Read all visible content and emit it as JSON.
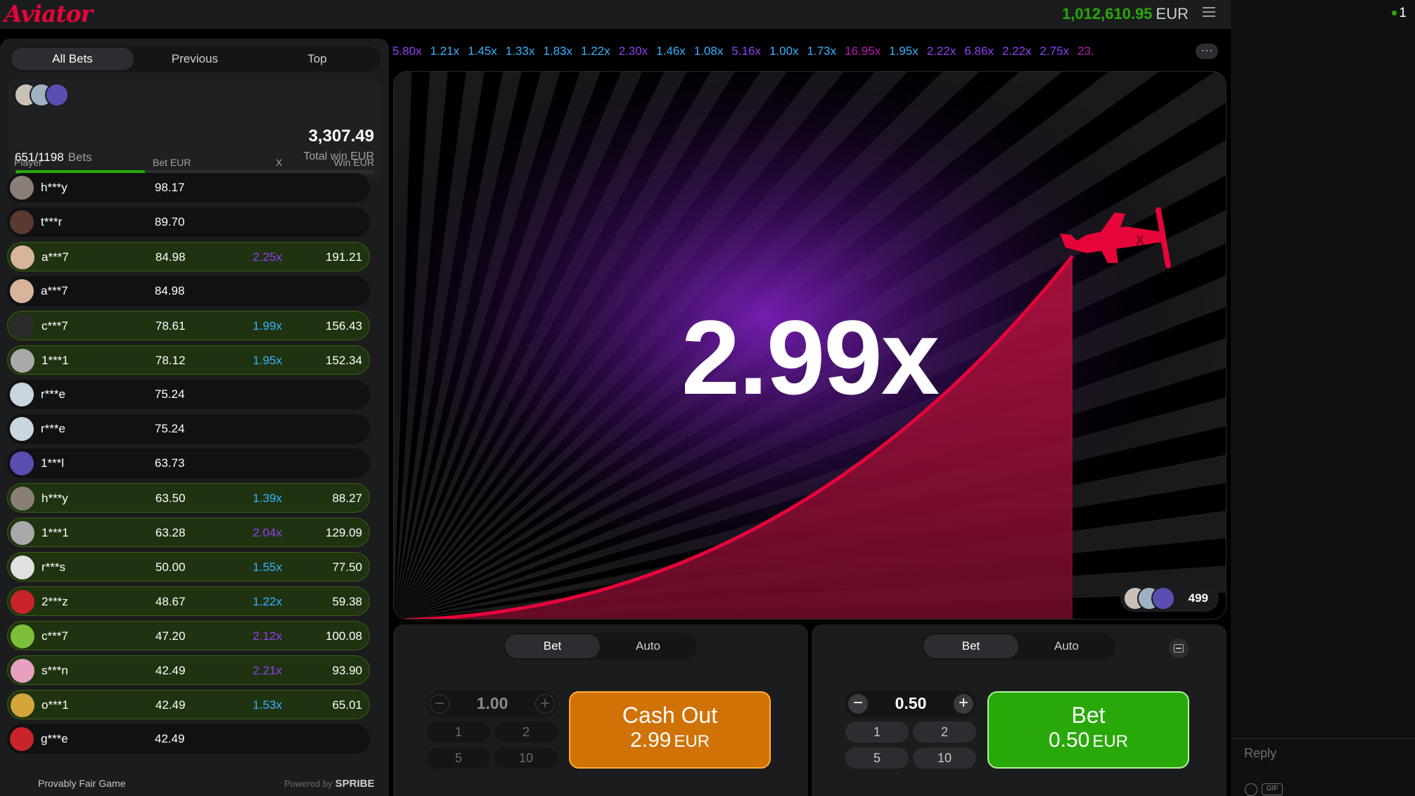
{
  "header": {
    "logo": "Aviator",
    "balance": "1,012,610.95",
    "currency": "EUR"
  },
  "left_panel": {
    "tabs": [
      {
        "label": "All Bets",
        "active": true
      },
      {
        "label": "Previous",
        "active": false
      },
      {
        "label": "Top",
        "active": false
      }
    ],
    "bets_count": "651/1198",
    "bets_label": "Bets",
    "bets_progress": 0.36,
    "total_win": "3,307.49",
    "total_win_label": "Total win EUR",
    "columns": {
      "player": "Player",
      "bet": "Bet EUR",
      "x": "X",
      "win": "Win EUR"
    },
    "rows": [
      {
        "player": "h***y",
        "bet": "98.17",
        "x": "",
        "win": "",
        "won": false,
        "x_color": "",
        "avatar_color": "#8a7f76"
      },
      {
        "player": "t***r",
        "bet": "89.70",
        "x": "",
        "win": "",
        "won": false,
        "x_color": "",
        "avatar_color": "#5a3a30"
      },
      {
        "player": "a***7",
        "bet": "84.98",
        "x": "2.25x",
        "win": "191.21",
        "won": true,
        "x_color": "#913ef8",
        "avatar_color": "#d9b49c"
      },
      {
        "player": "a***7",
        "bet": "84.98",
        "x": "",
        "win": "",
        "won": false,
        "x_color": "",
        "avatar_color": "#d9b49c"
      },
      {
        "player": "c***7",
        "bet": "78.61",
        "x": "1.99x",
        "win": "156.43",
        "won": true,
        "x_color": "#34b4ff",
        "avatar_color": "#2b2b2b"
      },
      {
        "player": "1***1",
        "bet": "78.12",
        "x": "1.95x",
        "win": "152.34",
        "won": true,
        "x_color": "#34b4ff",
        "avatar_color": "#a9a9a9"
      },
      {
        "player": "r***e",
        "bet": "75.24",
        "x": "",
        "win": "",
        "won": false,
        "x_color": "",
        "avatar_color": "#c9d6e0"
      },
      {
        "player": "r***e",
        "bet": "75.24",
        "x": "",
        "win": "",
        "won": false,
        "x_color": "",
        "avatar_color": "#c9d6e0"
      },
      {
        "player": "1***l",
        "bet": "63.73",
        "x": "",
        "win": "",
        "won": false,
        "x_color": "",
        "avatar_color": "#5a4fb0"
      },
      {
        "player": "h***y",
        "bet": "63.50",
        "x": "1.39x",
        "win": "88.27",
        "won": true,
        "x_color": "#34b4ff",
        "avatar_color": "#8a7f76"
      },
      {
        "player": "1***1",
        "bet": "63.28",
        "x": "2.04x",
        "win": "129.09",
        "won": true,
        "x_color": "#913ef8",
        "avatar_color": "#a9a9a9"
      },
      {
        "player": "r***s",
        "bet": "50.00",
        "x": "1.55x",
        "win": "77.50",
        "won": true,
        "x_color": "#34b4ff",
        "avatar_color": "#e0e0e0"
      },
      {
        "player": "2***z",
        "bet": "48.67",
        "x": "1.22x",
        "win": "59.38",
        "won": true,
        "x_color": "#34b4ff",
        "avatar_color": "#c8242a"
      },
      {
        "player": "c***7",
        "bet": "47.20",
        "x": "2.12x",
        "win": "100.08",
        "won": true,
        "x_color": "#913ef8",
        "avatar_color": "#7bbf3a"
      },
      {
        "player": "s***n",
        "bet": "42.49",
        "x": "2.21x",
        "win": "93.90",
        "won": true,
        "x_color": "#913ef8",
        "avatar_color": "#e7a0c0"
      },
      {
        "player": "o***1",
        "bet": "42.49",
        "x": "1.53x",
        "win": "65.01",
        "won": true,
        "x_color": "#34b4ff",
        "avatar_color": "#d4a53a"
      },
      {
        "player": "g***e",
        "bet": "42.49",
        "x": "",
        "win": "",
        "won": false,
        "x_color": "",
        "avatar_color": "#c8242a"
      }
    ],
    "footer_fair": "Provably Fair Game",
    "footer_powered": "Powered by",
    "footer_brand": "SPRIBE"
  },
  "history": [
    {
      "v": "5.80x",
      "c": "purple"
    },
    {
      "v": "1.21x",
      "c": "blue"
    },
    {
      "v": "1.45x",
      "c": "blue"
    },
    {
      "v": "1.33x",
      "c": "blue"
    },
    {
      "v": "1.83x",
      "c": "blue"
    },
    {
      "v": "1.22x",
      "c": "blue"
    },
    {
      "v": "2.30x",
      "c": "purple"
    },
    {
      "v": "1.46x",
      "c": "blue"
    },
    {
      "v": "1.08x",
      "c": "blue"
    },
    {
      "v": "5.16x",
      "c": "purple"
    },
    {
      "v": "1.00x",
      "c": "blue"
    },
    {
      "v": "1.73x",
      "c": "blue"
    },
    {
      "v": "16.95x",
      "c": "pink"
    },
    {
      "v": "1.95x",
      "c": "blue"
    },
    {
      "v": "2.22x",
      "c": "purple"
    },
    {
      "v": "6.86x",
      "c": "purple"
    },
    {
      "v": "2.22x",
      "c": "purple"
    },
    {
      "v": "2.75x",
      "c": "purple"
    },
    {
      "v": "23.",
      "c": "pink"
    }
  ],
  "game": {
    "multiplier": "2.99x",
    "online_count": "499"
  },
  "panels": [
    {
      "tabs": [
        "Bet",
        "Auto"
      ],
      "stake": "1.00",
      "quick": [
        "1",
        "2",
        "5",
        "10"
      ],
      "button_line1": "Cash Out",
      "button_line2": "2.99",
      "button_currency": "EUR",
      "button_color": "#d07206",
      "button_border": "#ffad3a"
    },
    {
      "tabs": [
        "Bet",
        "Auto"
      ],
      "stake": "0.50",
      "quick": [
        "1",
        "2",
        "5",
        "10"
      ],
      "button_line1": "Bet",
      "button_line2": "0.50",
      "button_currency": "EUR",
      "button_color": "#28a909",
      "button_border": "#b2f2a3"
    }
  ],
  "chat": {
    "online": "1",
    "reply_placeholder": "Reply",
    "gif_label": "GIF"
  },
  "colors": {
    "accent_red": "#e50539",
    "win_green": "#28a909",
    "low_blue": "#34b4ff",
    "mid_purple": "#913ef8",
    "high_pink": "#c017b4"
  }
}
